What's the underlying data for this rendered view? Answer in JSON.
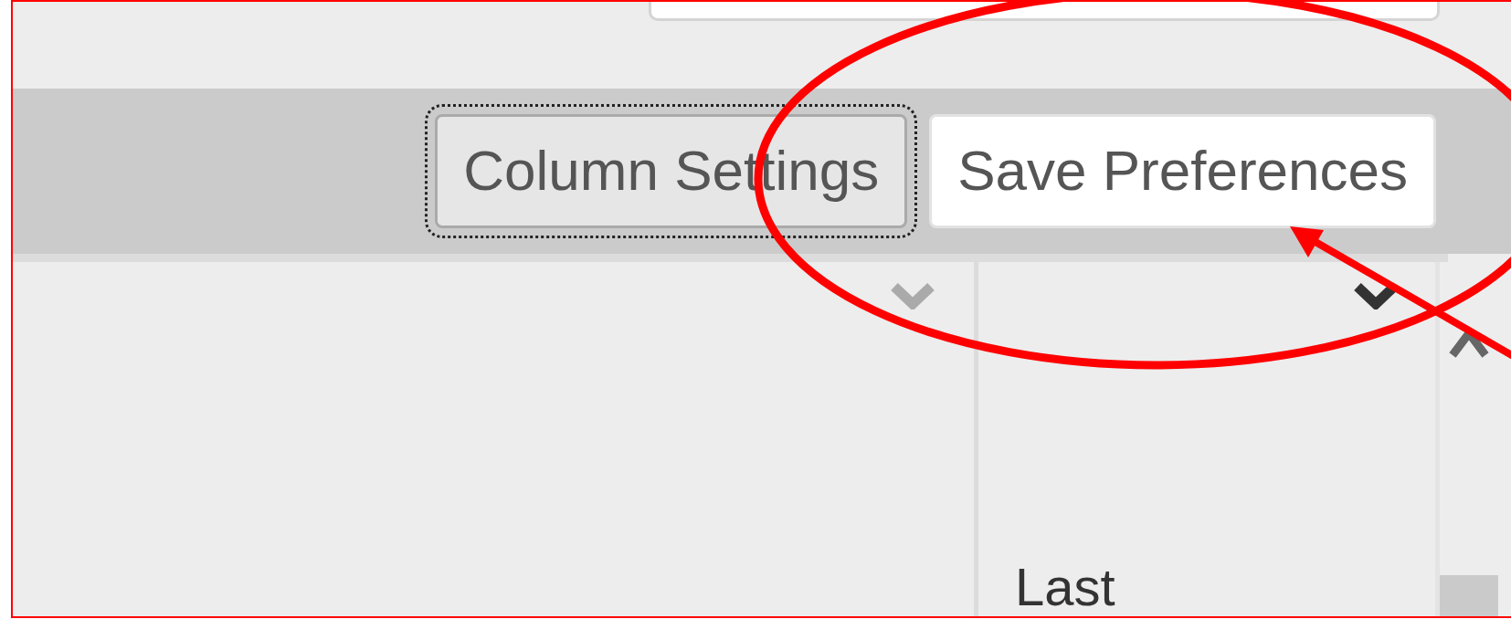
{
  "toolbar": {
    "buttons": [
      {
        "label": "Column Settings",
        "focused": true
      },
      {
        "label": "Save Preferences",
        "focused": false
      }
    ]
  },
  "table": {
    "columns": [
      {
        "sort_active": false
      },
      {
        "sort_active": true
      }
    ],
    "rows": [
      {
        "column_2": "Last"
      }
    ]
  }
}
